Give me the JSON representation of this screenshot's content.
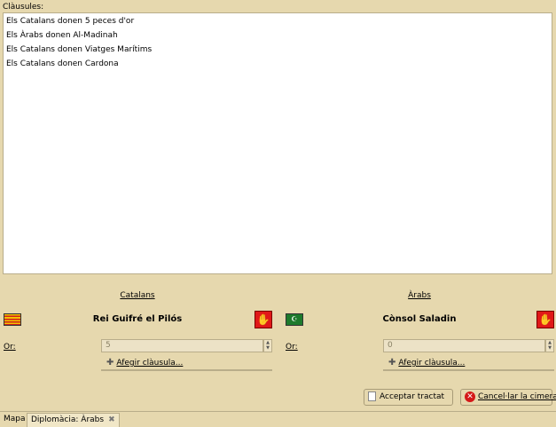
{
  "clauses": {
    "label": "Clàusules:",
    "items": [
      "Els Catalans donen 5 peces d'or",
      "Els Àrabs donen Al-Madinah",
      "Els Catalans donen Viatges Marítims",
      "Els Catalans donen Cardona"
    ]
  },
  "left_party": {
    "nation": "Catalans",
    "leader": "Rei Guifré el Pilós",
    "gold_label": "Or:",
    "gold_value": "5",
    "add_clause": "Afegir clàusula..."
  },
  "right_party": {
    "nation": "Àrabs",
    "leader": "Cònsol Saladin",
    "gold_label": "Or:",
    "gold_value": "0",
    "add_clause": "Afegir clàusula..."
  },
  "actions": {
    "accept": "Acceptar tractat",
    "cancel": "Cancel·lar la cimera"
  },
  "tabs": [
    {
      "label": "Mapa"
    },
    {
      "label": "Diplomàcia: Àrabs"
    }
  ],
  "icons": {
    "left_flag": "catalan-flag-icon",
    "right_flag": "arab-flag-icon",
    "thumbs_down": "thumbs-down-icon",
    "add": "plus-icon",
    "accept": "document-icon",
    "cancel": "cancel-icon",
    "close_tab": "close-icon"
  }
}
